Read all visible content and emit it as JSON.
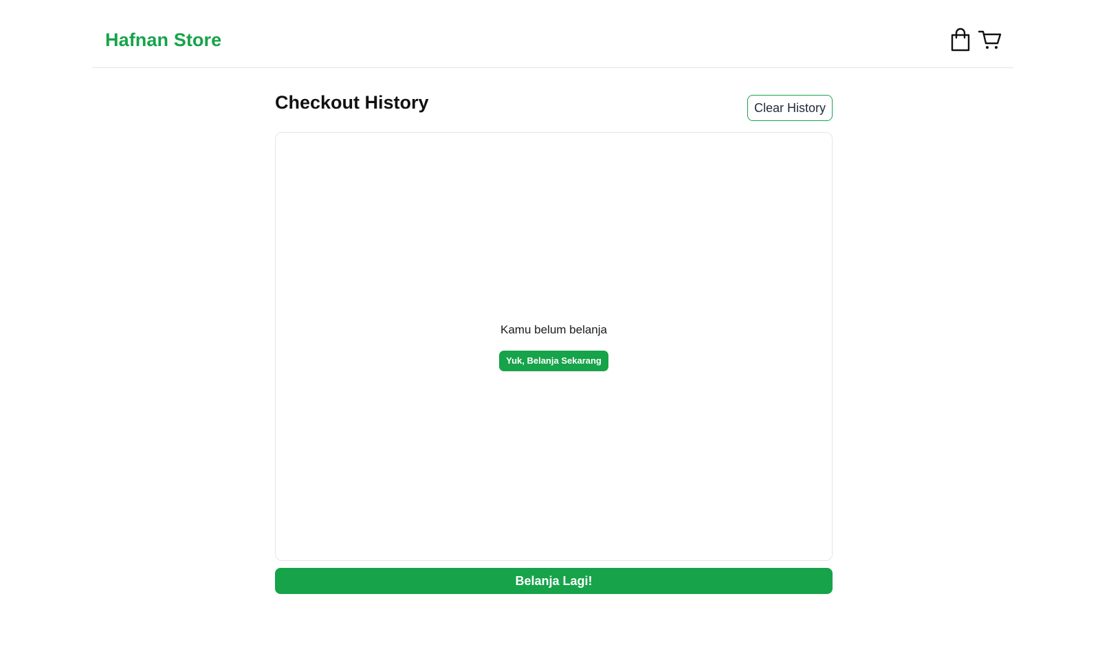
{
  "navbar": {
    "brand": "Hafnan Store",
    "icons": [
      "shopping-bag-icon",
      "cart-icon"
    ]
  },
  "page": {
    "title": "Checkout History",
    "clear_label": "Clear History"
  },
  "history": {
    "empty_text": "Kamu belum belanja",
    "shop_now_label": "Yuk, Belanja Sekarang"
  },
  "footer": {
    "shop_again_label": "Belanja Lagi!"
  },
  "colors": {
    "brand": "#16a34a",
    "text": "#111111",
    "border": "#e5e5e5"
  }
}
